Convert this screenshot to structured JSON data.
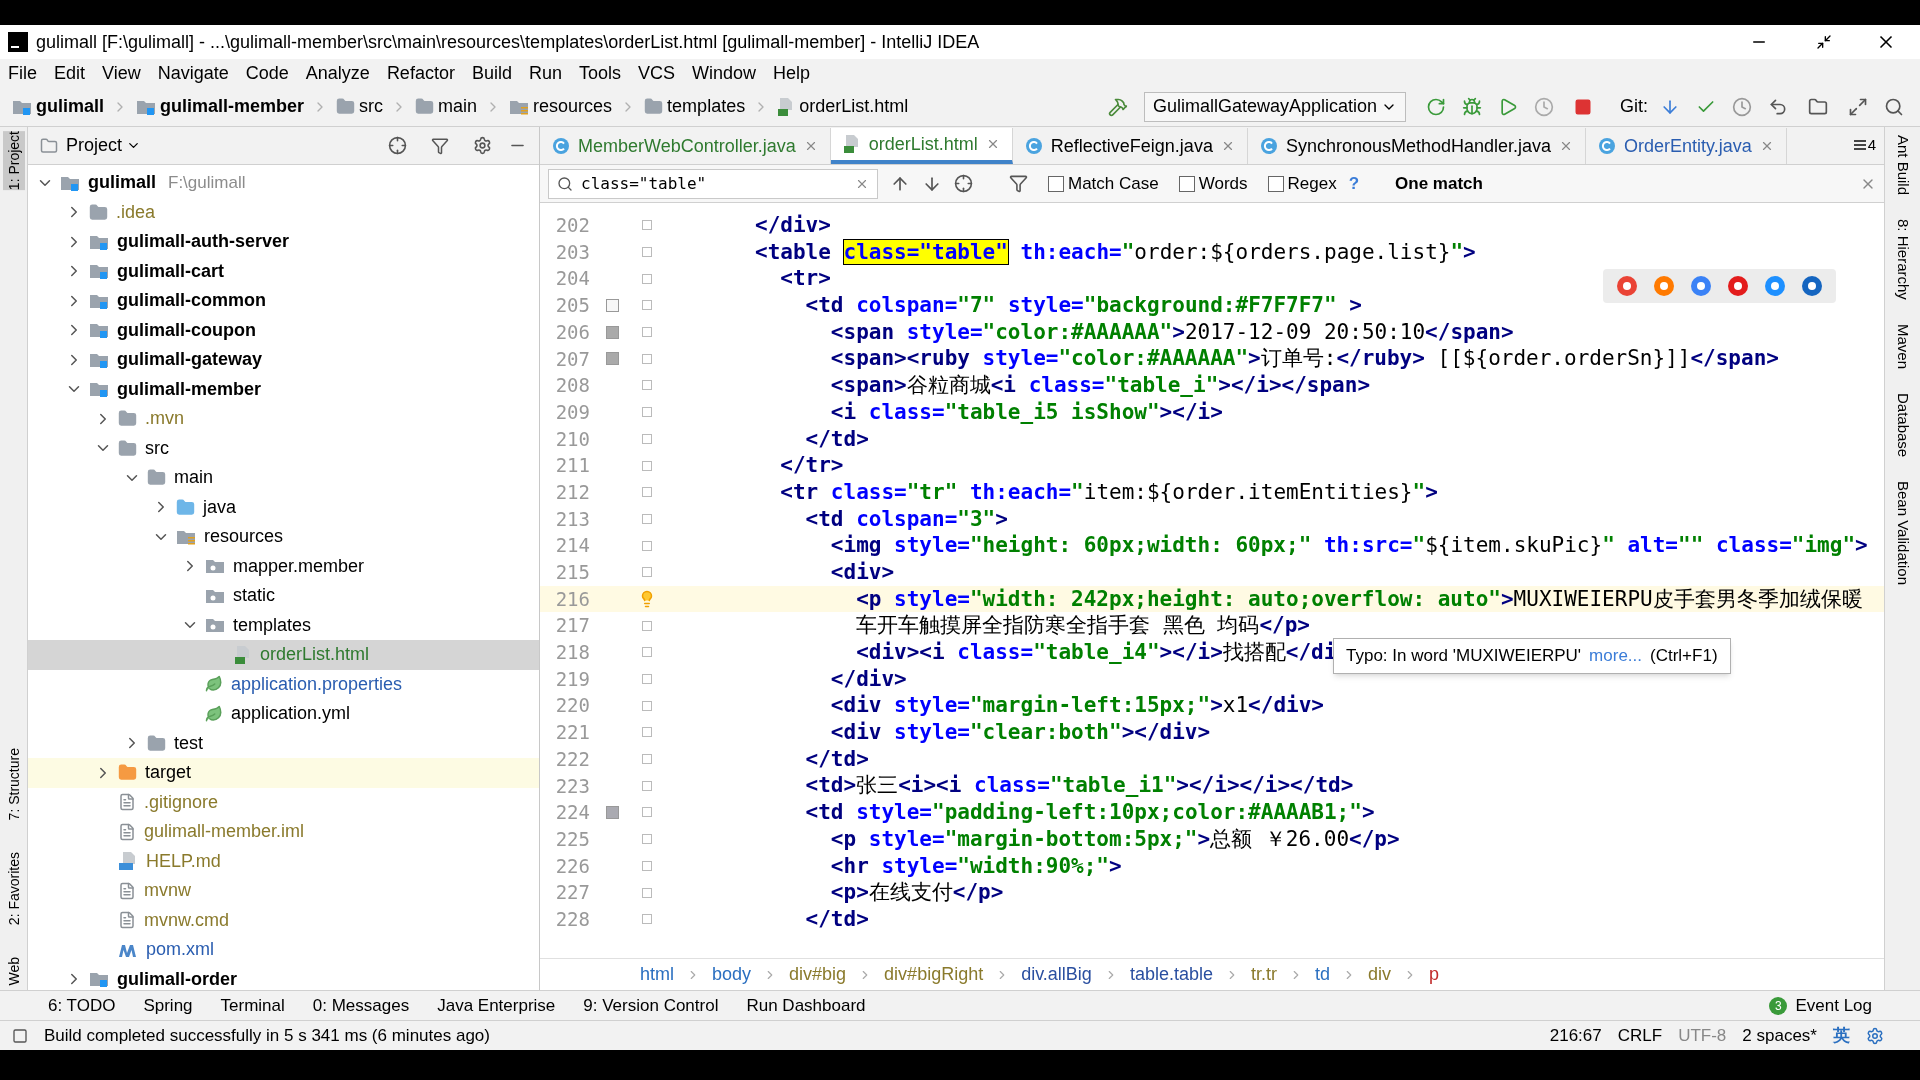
{
  "window": {
    "title": "gulimall [F:\\gulimall] - ...\\gulimall-member\\src\\main\\resources\\templates\\orderList.html [gulimall-member] - IntelliJ IDEA"
  },
  "menu": [
    "File",
    "Edit",
    "View",
    "Navigate",
    "Code",
    "Analyze",
    "Refactor",
    "Build",
    "Run",
    "Tools",
    "VCS",
    "Window",
    "Help"
  ],
  "nav_bar": {
    "crumbs": [
      {
        "label": "gulimall",
        "kind": "module"
      },
      {
        "label": "gulimall-member",
        "kind": "module"
      },
      {
        "label": "src",
        "kind": "folder"
      },
      {
        "label": "main",
        "kind": "folder"
      },
      {
        "label": "resources",
        "kind": "resources"
      },
      {
        "label": "templates",
        "kind": "folder"
      },
      {
        "label": "orderList.html",
        "kind": "html"
      }
    ],
    "run_config": "GulimallGatewayApplication",
    "git_label": "Git:"
  },
  "left_tool_strip": [
    {
      "label": "1: Project",
      "selected": true
    },
    {
      "label": "7: Structure",
      "selected": false
    },
    {
      "label": "2: Favorites",
      "selected": false
    },
    {
      "label": "Web",
      "selected": false
    }
  ],
  "project_panel": {
    "title": "Project",
    "tree": [
      {
        "label": "gulimall",
        "hint": "F:\\gulimall",
        "kind": "module",
        "expanded": true,
        "selected": false,
        "color": "#000000",
        "children": [
          {
            "label": ".idea",
            "kind": "folder",
            "expanded": false,
            "selected": false,
            "color": "#8a7a2c"
          },
          {
            "label": "gulimall-auth-server",
            "kind": "module",
            "expanded": false,
            "selected": false,
            "color": "#000000"
          },
          {
            "label": "gulimall-cart",
            "kind": "module",
            "expanded": false,
            "selected": false,
            "color": "#000000"
          },
          {
            "label": "gulimall-common",
            "kind": "module",
            "expanded": false,
            "selected": false,
            "color": "#000000"
          },
          {
            "label": "gulimall-coupon",
            "kind": "module",
            "expanded": false,
            "selected": false,
            "color": "#000000"
          },
          {
            "label": "gulimall-gateway",
            "kind": "module",
            "expanded": false,
            "selected": false,
            "color": "#000000"
          },
          {
            "label": "gulimall-member",
            "kind": "module",
            "expanded": true,
            "selected": false,
            "color": "#000000",
            "children": [
              {
                "label": ".mvn",
                "kind": "folder",
                "expanded": false,
                "selected": false,
                "color": "#8a7a2c"
              },
              {
                "label": "src",
                "kind": "folder",
                "expanded": true,
                "selected": false,
                "color": "#000000",
                "children": [
                  {
                    "label": "main",
                    "kind": "folder",
                    "expanded": true,
                    "selected": false,
                    "color": "#000000",
                    "children": [
                      {
                        "label": "java",
                        "kind": "source",
                        "expanded": false,
                        "selected": false,
                        "color": "#000000"
                      },
                      {
                        "label": "resources",
                        "kind": "resources",
                        "expanded": true,
                        "selected": false,
                        "color": "#000000",
                        "children": [
                          {
                            "label": "mapper.member",
                            "kind": "package",
                            "expanded": false,
                            "selected": false,
                            "color": "#000000"
                          },
                          {
                            "label": "static",
                            "kind": "package",
                            "selected": false,
                            "color": "#000000"
                          },
                          {
                            "label": "templates",
                            "kind": "package",
                            "expanded": true,
                            "selected": false,
                            "color": "#000000",
                            "children": [
                              {
                                "label": "orderList.html",
                                "kind": "html",
                                "selected": true,
                                "color": "#2f7a2f"
                              }
                            ]
                          },
                          {
                            "label": "application.properties",
                            "kind": "config",
                            "selected": false,
                            "color": "#2a5db0"
                          },
                          {
                            "label": "application.yml",
                            "kind": "config",
                            "selected": false,
                            "color": "#000000"
                          }
                        ]
                      }
                    ]
                  },
                  {
                    "label": "test",
                    "kind": "folder",
                    "expanded": false,
                    "selected": false,
                    "color": "#000000"
                  }
                ]
              },
              {
                "label": "target",
                "kind": "excluded",
                "expanded": false,
                "selected": false,
                "color": "#000000"
              },
              {
                "label": ".gitignore",
                "kind": "file",
                "selected": false,
                "color": "#8a7a2c"
              },
              {
                "label": "gulimall-member.iml",
                "kind": "file",
                "selected": false,
                "color": "#8a7a2c"
              },
              {
                "label": "HELP.md",
                "kind": "md",
                "selected": false,
                "color": "#8a7a2c"
              },
              {
                "label": "mvnw",
                "kind": "file",
                "selected": false,
                "color": "#8a7a2c"
              },
              {
                "label": "mvnw.cmd",
                "kind": "file",
                "selected": false,
                "color": "#8a7a2c"
              },
              {
                "label": "pom.xml",
                "kind": "maven",
                "selected": false,
                "color": "#2a5db0"
              }
            ]
          },
          {
            "label": "gulimall-order",
            "kind": "module",
            "expanded": false,
            "selected": false,
            "color": "#000000"
          }
        ]
      }
    ]
  },
  "editor_tabs": [
    {
      "label": "MemberWebController.java",
      "kind": "class",
      "selected": false,
      "color": "#2f7a2f"
    },
    {
      "label": "orderList.html",
      "kind": "html",
      "selected": true,
      "color": "#2f7a2f"
    },
    {
      "label": "ReflectiveFeign.java",
      "kind": "class",
      "selected": false,
      "color": "#000000"
    },
    {
      "label": "SynchronousMethodHandler.java",
      "kind": "class",
      "selected": false,
      "color": "#000000"
    },
    {
      "label": "OrderEntity.java",
      "kind": "class",
      "selected": false,
      "color": "#2a5db0"
    }
  ],
  "tabs_overflow": "4",
  "find_bar": {
    "query": "class=\"table\"",
    "options": [
      {
        "label": "Match Case",
        "checked": false
      },
      {
        "label": "Words",
        "checked": false
      },
      {
        "label": "Regex",
        "checked": false
      }
    ],
    "help": "?",
    "result": "One match"
  },
  "code": [
    {
      "n": "202",
      "current": false,
      "tokens": [
        {
          "kind": "tag",
          "text": "</div>"
        }
      ]
    },
    {
      "n": "203",
      "current": false,
      "tokens": [
        {
          "kind": "tag",
          "text": "<table "
        },
        {
          "kind": "match",
          "text": "class=\"table\""
        },
        {
          "kind": "attr",
          "text": " th:each="
        },
        {
          "kind": "str",
          "text": "\""
        },
        {
          "kind": "text",
          "text": "order:${orders.page.list}"
        },
        {
          "kind": "str",
          "text": "\""
        },
        {
          "kind": "tag",
          "text": ">"
        }
      ]
    },
    {
      "n": "204",
      "current": false,
      "tokens": [
        {
          "kind": "tag",
          "text": "  <tr>"
        }
      ]
    },
    {
      "n": "205",
      "current": false,
      "color": "#f7f7f7",
      "tokens": [
        {
          "kind": "tag",
          "text": "    <td "
        },
        {
          "kind": "attr",
          "text": "colspan="
        },
        {
          "kind": "str",
          "text": "\"7\""
        },
        {
          "kind": "attr",
          "text": " style="
        },
        {
          "kind": "str",
          "text": "\"background:#F7F7F7\""
        },
        {
          "kind": "tag",
          "text": " >"
        }
      ]
    },
    {
      "n": "206",
      "current": false,
      "color": "#aaaaaa",
      "tokens": [
        {
          "kind": "tag",
          "text": "      <span "
        },
        {
          "kind": "attr",
          "text": "style="
        },
        {
          "kind": "str",
          "text": "\"color:#AAAAAA\""
        },
        {
          "kind": "tag",
          "text": ">"
        },
        {
          "kind": "text",
          "text": "2017-12-09 20:50:10"
        },
        {
          "kind": "tag",
          "text": "</span>"
        }
      ]
    },
    {
      "n": "207",
      "current": false,
      "color": "#aaaaaa",
      "tokens": [
        {
          "kind": "tag",
          "text": "      <span><ruby "
        },
        {
          "kind": "attr",
          "text": "style="
        },
        {
          "kind": "str",
          "text": "\"color:#AAAAAA\""
        },
        {
          "kind": "tag",
          "text": ">"
        },
        {
          "kind": "text",
          "text": "订单号:"
        },
        {
          "kind": "tag",
          "text": "</ruby>"
        },
        {
          "kind": "text",
          "text": " [[${order.orderSn}]]"
        },
        {
          "kind": "tag",
          "text": "</span>"
        }
      ]
    },
    {
      "n": "208",
      "current": false,
      "tokens": [
        {
          "kind": "tag",
          "text": "      <span>"
        },
        {
          "kind": "text",
          "text": "谷粒商城"
        },
        {
          "kind": "tag",
          "text": "<i "
        },
        {
          "kind": "attr",
          "text": "class="
        },
        {
          "kind": "str",
          "text": "\"table_i\""
        },
        {
          "kind": "tag",
          "text": "></i></span>"
        }
      ]
    },
    {
      "n": "209",
      "current": false,
      "tokens": [
        {
          "kind": "tag",
          "text": "      <i "
        },
        {
          "kind": "attr",
          "text": "class="
        },
        {
          "kind": "str",
          "text": "\"table_i5 isShow\""
        },
        {
          "kind": "tag",
          "text": "></i>"
        }
      ]
    },
    {
      "n": "210",
      "current": false,
      "tokens": [
        {
          "kind": "tag",
          "text": "    </td>"
        }
      ]
    },
    {
      "n": "211",
      "current": false,
      "tokens": [
        {
          "kind": "tag",
          "text": "  </tr>"
        }
      ]
    },
    {
      "n": "212",
      "current": false,
      "tokens": [
        {
          "kind": "tag",
          "text": "  <tr "
        },
        {
          "kind": "attr",
          "text": "class="
        },
        {
          "kind": "str",
          "text": "\"tr\""
        },
        {
          "kind": "attr",
          "text": " th:each="
        },
        {
          "kind": "str",
          "text": "\""
        },
        {
          "kind": "text",
          "text": "item:${order.itemEntities}"
        },
        {
          "kind": "str",
          "text": "\""
        },
        {
          "kind": "tag",
          "text": ">"
        }
      ]
    },
    {
      "n": "213",
      "current": false,
      "tokens": [
        {
          "kind": "tag",
          "text": "    <td "
        },
        {
          "kind": "attr",
          "text": "colspan="
        },
        {
          "kind": "str",
          "text": "\"3\""
        },
        {
          "kind": "tag",
          "text": ">"
        }
      ]
    },
    {
      "n": "214",
      "current": false,
      "tokens": [
        {
          "kind": "tag",
          "text": "      <img "
        },
        {
          "kind": "attr",
          "text": "style="
        },
        {
          "kind": "str",
          "text": "\"height: 60px;width: 60px;\""
        },
        {
          "kind": "attr",
          "text": " th:src="
        },
        {
          "kind": "str",
          "text": "\""
        },
        {
          "kind": "text",
          "text": "${item.skuPic}"
        },
        {
          "kind": "str",
          "text": "\""
        },
        {
          "kind": "attr",
          "text": " alt="
        },
        {
          "kind": "str",
          "text": "\"\""
        },
        {
          "kind": "attr",
          "text": " class="
        },
        {
          "kind": "str",
          "text": "\"img\""
        },
        {
          "kind": "tag",
          "text": ">"
        }
      ]
    },
    {
      "n": "215",
      "current": false,
      "tokens": [
        {
          "kind": "tag",
          "text": "      <div>"
        }
      ]
    },
    {
      "n": "216",
      "current": true,
      "tokens": [
        {
          "kind": "tag",
          "text": "        <p "
        },
        {
          "kind": "attr",
          "text": "style="
        },
        {
          "kind": "str",
          "text": "\"width: 242px;height: auto;overflow: auto\""
        },
        {
          "kind": "tag",
          "text": ">"
        },
        {
          "kind": "text",
          "text": "MUXIWEIERPU皮手套男冬季加绒保暖"
        }
      ]
    },
    {
      "n": "217",
      "current": false,
      "tokens": [
        {
          "kind": "text",
          "text": "        车开车触摸屏全指防寒全指手套 黑色 均码"
        },
        {
          "kind": "tag",
          "text": "</p>"
        }
      ]
    },
    {
      "n": "218",
      "current": false,
      "tokens": [
        {
          "kind": "tag",
          "text": "        <div><i "
        },
        {
          "kind": "attr",
          "text": "class="
        },
        {
          "kind": "str",
          "text": "\"table_i4\""
        },
        {
          "kind": "tag",
          "text": "></i>"
        },
        {
          "kind": "text",
          "text": "找搭配"
        },
        {
          "kind": "tag",
          "text": "</di"
        }
      ]
    },
    {
      "n": "219",
      "current": false,
      "tokens": [
        {
          "kind": "tag",
          "text": "      </div>"
        }
      ]
    },
    {
      "n": "220",
      "current": false,
      "tokens": [
        {
          "kind": "tag",
          "text": "      <div "
        },
        {
          "kind": "attr",
          "text": "style="
        },
        {
          "kind": "str",
          "text": "\"margin-left:15px;\""
        },
        {
          "kind": "tag",
          "text": ">"
        },
        {
          "kind": "text",
          "text": "x1"
        },
        {
          "kind": "tag",
          "text": "</div>"
        }
      ]
    },
    {
      "n": "221",
      "current": false,
      "tokens": [
        {
          "kind": "tag",
          "text": "      <div "
        },
        {
          "kind": "attr",
          "text": "style="
        },
        {
          "kind": "str",
          "text": "\"clear:both\""
        },
        {
          "kind": "tag",
          "text": "></div>"
        }
      ]
    },
    {
      "n": "222",
      "current": false,
      "tokens": [
        {
          "kind": "tag",
          "text": "    </td>"
        }
      ]
    },
    {
      "n": "223",
      "current": false,
      "tokens": [
        {
          "kind": "tag",
          "text": "    <td>"
        },
        {
          "kind": "text",
          "text": "张三"
        },
        {
          "kind": "tag",
          "text": "<i><i "
        },
        {
          "kind": "attr",
          "text": "class="
        },
        {
          "kind": "str",
          "text": "\"table_i1\""
        },
        {
          "kind": "tag",
          "text": "></i></i></td>"
        }
      ]
    },
    {
      "n": "224",
      "current": false,
      "color": "#aaaab1",
      "tokens": [
        {
          "kind": "tag",
          "text": "    <td "
        },
        {
          "kind": "attr",
          "text": "style="
        },
        {
          "kind": "str",
          "text": "\"padding-left:10px;color:#AAAAB1;\""
        },
        {
          "kind": "tag",
          "text": ">"
        }
      ]
    },
    {
      "n": "225",
      "current": false,
      "tokens": [
        {
          "kind": "tag",
          "text": "      <p "
        },
        {
          "kind": "attr",
          "text": "style="
        },
        {
          "kind": "str",
          "text": "\"margin-bottom:5px;\""
        },
        {
          "kind": "tag",
          "text": ">"
        },
        {
          "kind": "text",
          "text": "总额 ￥26.00"
        },
        {
          "kind": "tag",
          "text": "</p>"
        }
      ]
    },
    {
      "n": "226",
      "current": false,
      "tokens": [
        {
          "kind": "tag",
          "text": "      <hr "
        },
        {
          "kind": "attr",
          "text": "style="
        },
        {
          "kind": "str",
          "text": "\"width:90%;\""
        },
        {
          "kind": "tag",
          "text": ">"
        }
      ]
    },
    {
      "n": "227",
      "current": false,
      "tokens": [
        {
          "kind": "tag",
          "text": "      <p>"
        },
        {
          "kind": "text",
          "text": "在线支付"
        },
        {
          "kind": "tag",
          "text": "</p>"
        }
      ]
    },
    {
      "n": "228",
      "current": false,
      "tokens": [
        {
          "kind": "tag",
          "text": "    </td>"
        }
      ]
    }
  ],
  "tooltip": {
    "text": "Typo: In word 'MUXIWEIERPU'",
    "link": "more...",
    "shortcut": "(Ctrl+F1)"
  },
  "breadcrumbs": [
    {
      "label": "html",
      "kind": "tag"
    },
    {
      "label": "body",
      "kind": "tag"
    },
    {
      "label": "div#big",
      "kind": "id"
    },
    {
      "label": "div#bigRight",
      "kind": "id"
    },
    {
      "label": "div.allBig",
      "kind": "class"
    },
    {
      "label": "table.table",
      "kind": "class"
    },
    {
      "label": "tr.tr",
      "kind": "id"
    },
    {
      "label": "td",
      "kind": "tag"
    },
    {
      "label": "div",
      "kind": "id"
    },
    {
      "label": "p",
      "kind": "last"
    }
  ],
  "right_tool_strip": [
    "Ant Build",
    "8: Hierarchy",
    "Maven",
    "Database",
    "Bean Validation"
  ],
  "bottom_tools": [
    "6: TODO",
    "Spring",
    "Terminal",
    "0: Messages",
    "Java Enterprise",
    "9: Version Control",
    "Run Dashboard"
  ],
  "event_log": {
    "label": "Event Log",
    "count": "3"
  },
  "status_bar": {
    "message": "Build completed successfully in 5 s 341 ms (6 minutes ago)",
    "position": "216:67",
    "line_separator": "CRLF",
    "encoding": "UTF-8",
    "indent": "2 spaces*",
    "ime": "英"
  }
}
